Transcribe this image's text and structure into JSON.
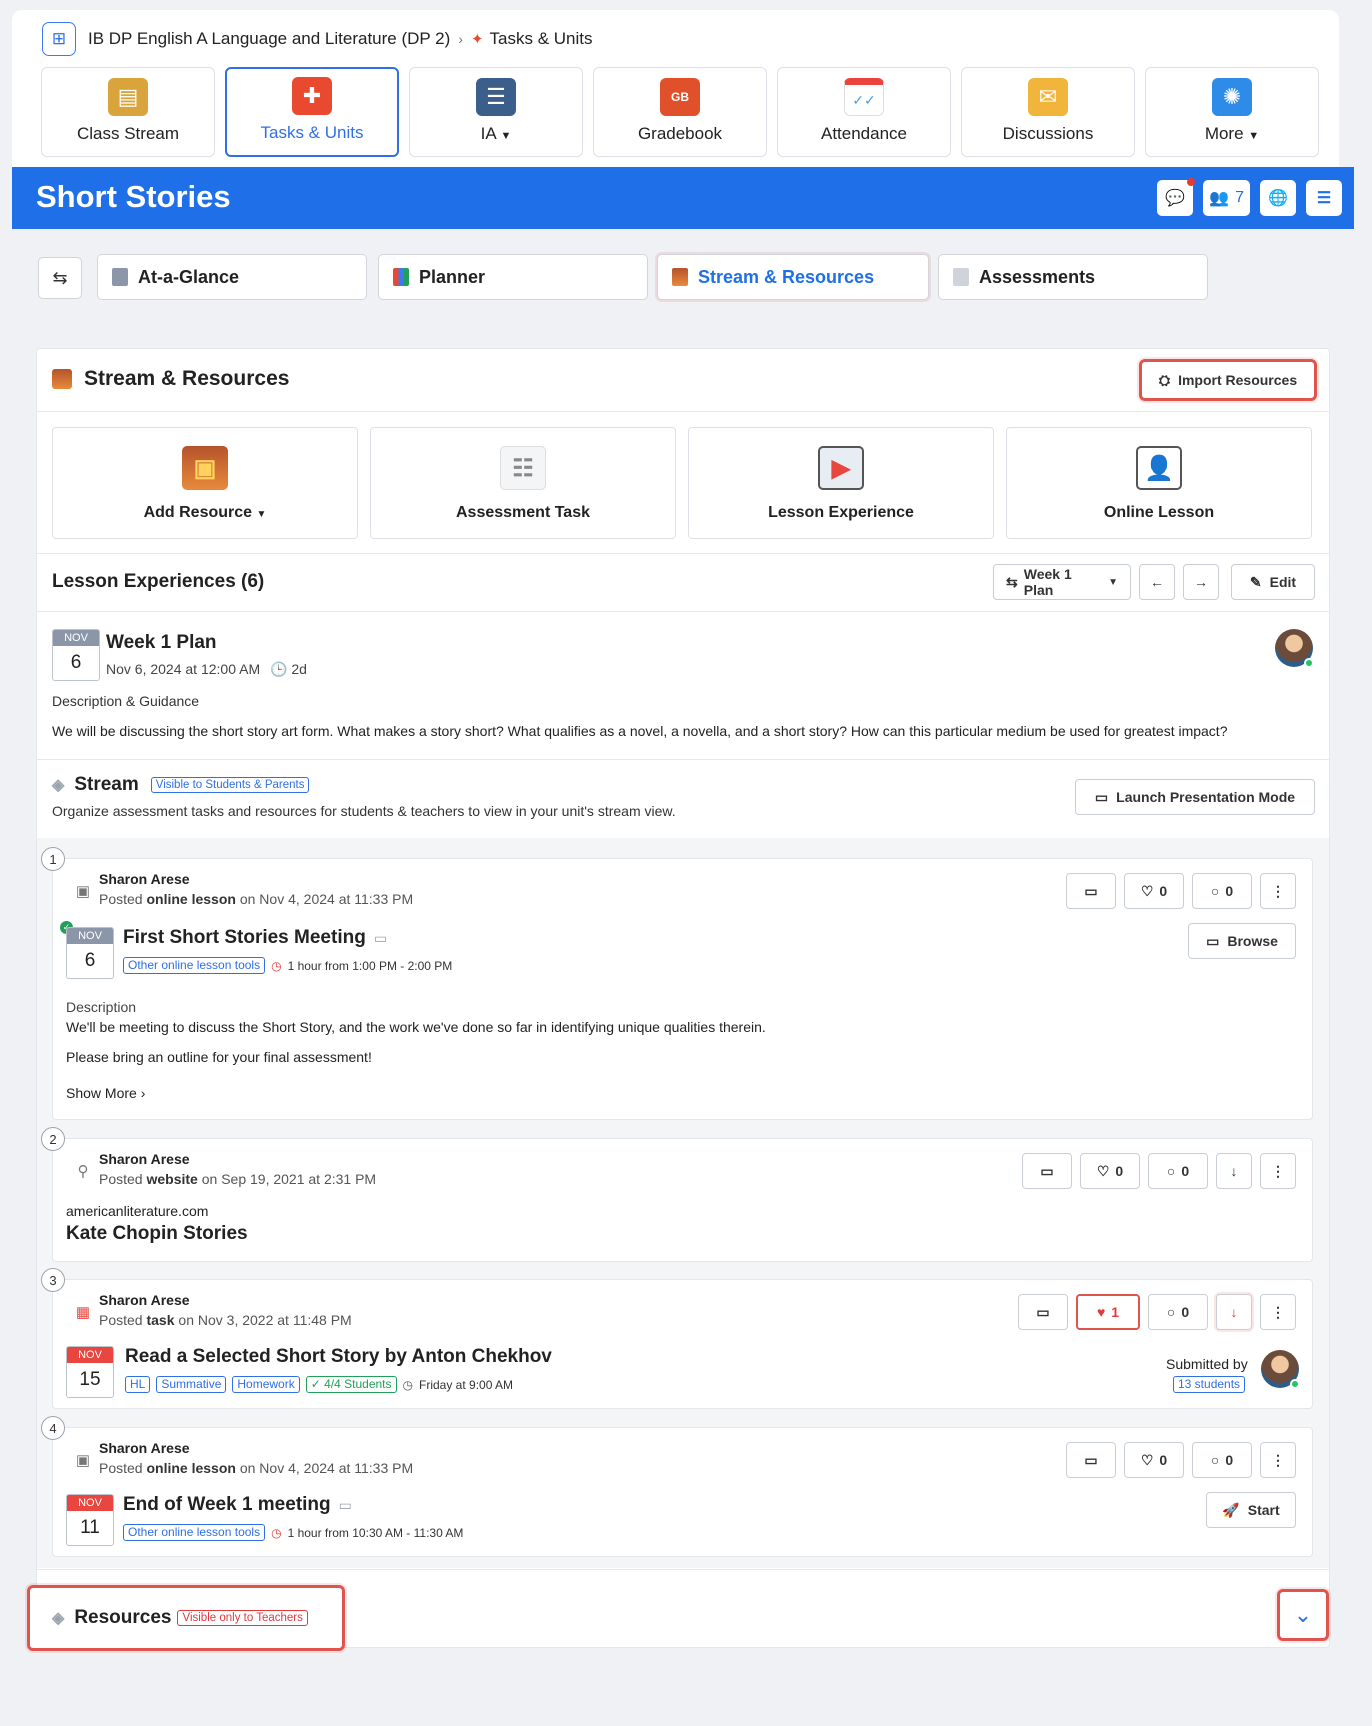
{
  "breadcrumb": {
    "course": "IB DP English A Language and Literature (DP 2)",
    "current": "Tasks & Units"
  },
  "nav_tiles": [
    {
      "label": "Class Stream",
      "color": "#d9a43b"
    },
    {
      "label": "Tasks & Units",
      "color": "#e8492f"
    },
    {
      "label": "IA",
      "color": "#3b5f8a"
    },
    {
      "label": "Gradebook",
      "color": "#e0502a"
    },
    {
      "label": "Attendance",
      "color": "#e9453c"
    },
    {
      "label": "Discussions",
      "color": "#f2b53c"
    },
    {
      "label": "More",
      "color": "#2f8be8"
    }
  ],
  "header": {
    "title": "Short Stories",
    "member_count": "7"
  },
  "subtabs": [
    "At-a-Glance",
    "Planner",
    "Stream & Resources",
    "Assessments"
  ],
  "section": {
    "title": "Stream & Resources",
    "import_label": "Import Resources"
  },
  "add_tiles": [
    "Add Resource",
    "Assessment Task",
    "Lesson Experience",
    "Online Lesson"
  ],
  "lesson_experiences": {
    "title": "Lesson Experiences (6)",
    "plan_label": "Week 1 Plan",
    "edit_label": "Edit"
  },
  "week_plan": {
    "month": "NOV",
    "day": "6",
    "title": "Week 1 Plan",
    "date": "Nov 6, 2024 at 12:00 AM",
    "duration": "2d",
    "desc_label": "Description & Guidance",
    "desc": "We will be discussing the short story art form. What makes a story short? What qualifies as a novel, a novella, and a short story? How can this particular medium be used for greatest impact?"
  },
  "stream": {
    "title": "Stream",
    "visibility": "Visible to Students & Parents",
    "subtitle": "Organize assessment tasks and resources for students & teachers to view in your unit's stream view.",
    "launch_label": "Launch Presentation Mode"
  },
  "posts": [
    {
      "num": "1",
      "author": "Sharon Arese",
      "posted_prefix": "Posted",
      "type": "online lesson",
      "posted_suffix": "on Nov 4, 2024 at 11:33 PM",
      "likes": "0",
      "comments": "0",
      "month": "NOV",
      "day": "6",
      "title": "First Short Stories Meeting",
      "tag": "Other online lesson tools",
      "time": "1 hour from 1:00 PM - 2:00 PM",
      "button": "Browse",
      "desc_label": "Description",
      "desc1": "We'll be meeting to discuss the Short Story, and the work we've done so far in identifying unique qualities therein.",
      "desc2": "Please bring an outline for your final assessment!",
      "more": "Show More"
    },
    {
      "num": "2",
      "author": "Sharon Arese",
      "posted_prefix": "Posted",
      "type": "website",
      "posted_suffix": "on Sep 19, 2021 at 2:31 PM",
      "likes": "0",
      "comments": "0",
      "domain": "americanliterature.com",
      "title": "Kate Chopin Stories"
    },
    {
      "num": "3",
      "author": "Sharon Arese",
      "posted_prefix": "Posted",
      "type": "task",
      "posted_suffix": "on Nov 3, 2022 at 11:48 PM",
      "likes": "1",
      "comments": "0",
      "month": "NOV",
      "day": "15",
      "title": "Read a Selected Short Story by Anton Chekhov",
      "tags": [
        "HL",
        "Summative",
        "Homework"
      ],
      "students_tag": "4/4 Students",
      "due": "Friday at 9:00 AM",
      "submitted_label": "Submitted by",
      "submitted_count": "13 students"
    },
    {
      "num": "4",
      "author": "Sharon Arese",
      "posted_prefix": "Posted",
      "type": "online lesson",
      "posted_suffix": "on Nov 4, 2024 at 11:33 PM",
      "likes": "0",
      "comments": "0",
      "month": "NOV",
      "day": "11",
      "title": "End of Week 1 meeting",
      "tag": "Other online lesson tools",
      "time": "1 hour from 10:30 AM - 11:30 AM",
      "button": "Start"
    }
  ],
  "resources": {
    "title": "Resources",
    "visibility": "Visible only to Teachers"
  }
}
